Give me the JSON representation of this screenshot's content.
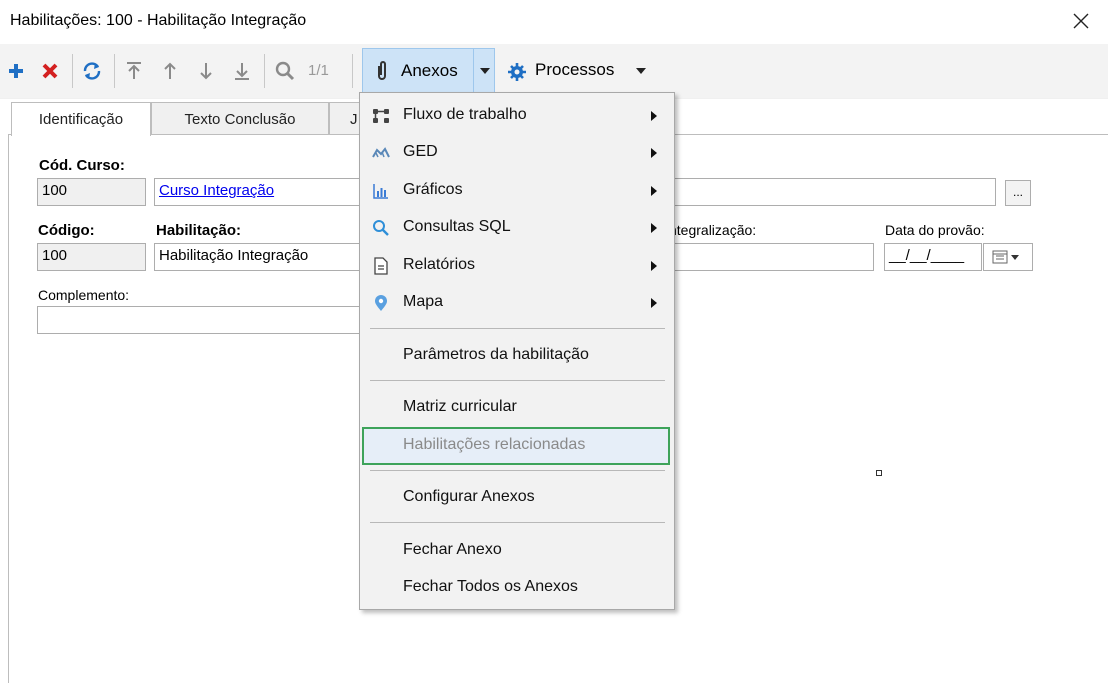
{
  "window": {
    "title": "Habilitações: 100 - Habilitação Integração"
  },
  "toolbar": {
    "pager": "1/1",
    "anexos_label": "Anexos",
    "processos_label": "Processos"
  },
  "tabs": [
    {
      "label": "Identificação"
    },
    {
      "label": "Texto Conclusão"
    },
    {
      "label": "J"
    }
  ],
  "form": {
    "cod_curso_label": "Cód. Curso:",
    "cod_curso_value": "100",
    "curso_link": "Curso Integração",
    "codigo_label": "Código:",
    "codigo_value": "100",
    "habilitacao_label": "Habilitação:",
    "habilitacao_value": "Habilitação Integração",
    "integralizacao_label": "ntegralização:",
    "data_provao_label": "Data do provão:",
    "data_provao_value": "__/__/____",
    "complemento_label": "Complemento:",
    "ellipsis": "..."
  },
  "menu": {
    "items": [
      {
        "label": "Fluxo de trabalho",
        "icon": "workflow-icon",
        "submenu": true
      },
      {
        "label": "GED",
        "icon": "ged-icon",
        "submenu": true
      },
      {
        "label": "Gráficos",
        "icon": "chart-icon",
        "submenu": true
      },
      {
        "label": "Consultas SQL",
        "icon": "search-icon",
        "submenu": true
      },
      {
        "label": "Relatórios",
        "icon": "report-icon",
        "submenu": true
      },
      {
        "label": "Mapa",
        "icon": "map-pin-icon",
        "submenu": true
      },
      {
        "label": "Parâmetros da habilitação"
      },
      {
        "label": "Matriz curricular"
      },
      {
        "label": "Habilitações relacionadas",
        "disabled": true,
        "highlighted": true
      },
      {
        "label": "Configurar Anexos"
      },
      {
        "label": "Fechar Anexo"
      },
      {
        "label": "Fechar Todos os Anexos"
      }
    ]
  },
  "colors": {
    "add": "#1f6fc4",
    "delete": "#d32020",
    "accent_highlight": "#3ea35a",
    "anexos_bg": "#cde3f7"
  }
}
